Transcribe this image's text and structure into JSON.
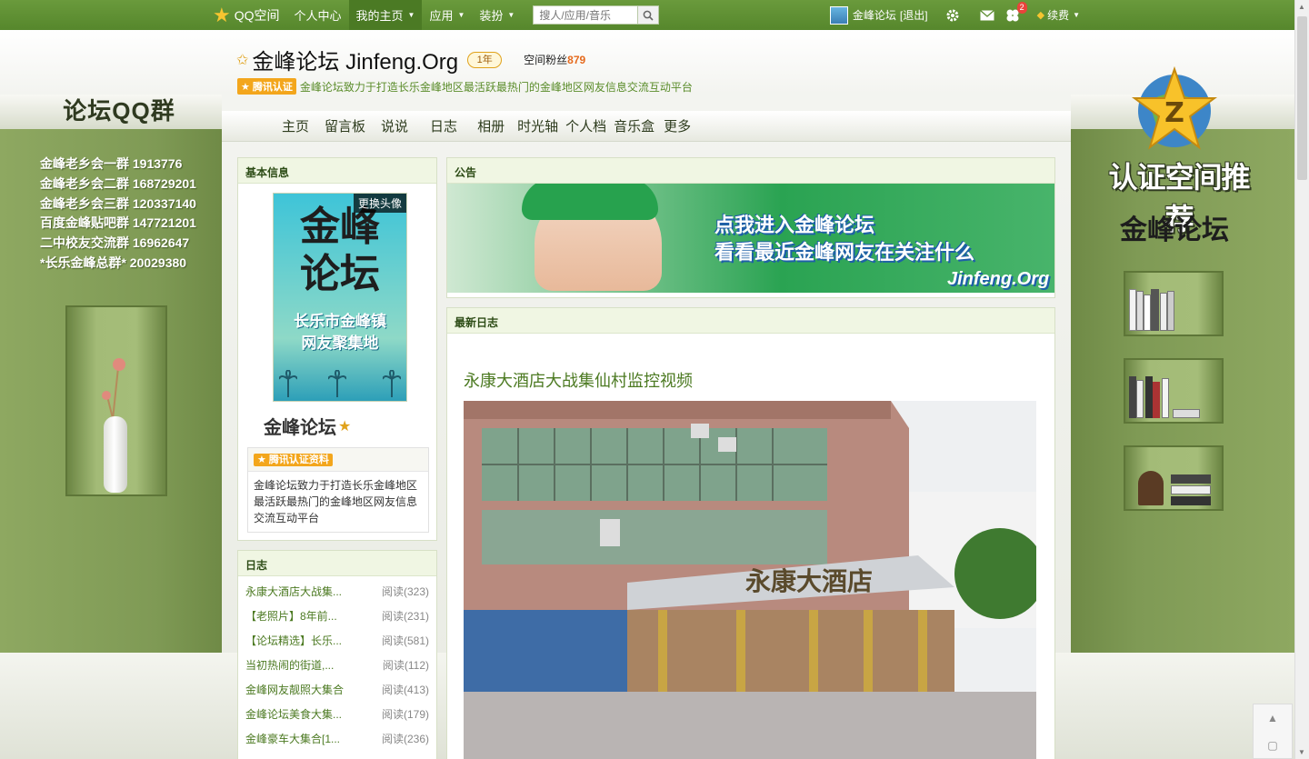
{
  "topbar": {
    "logo": "QQ空间",
    "nav": [
      "个人中心",
      "我的主页",
      "应用",
      "装扮"
    ],
    "search_placeholder": "搜人/应用/音乐",
    "user": "金峰论坛",
    "logout": "[退出]",
    "notification_count": "2",
    "renew": "续费"
  },
  "scene": {
    "left_title": "论坛QQ群",
    "qq_groups": [
      "金峰老乡会一群 1913776",
      "金峰老乡会二群 168729201",
      "金峰老乡会三群 120337140",
      "百度金峰贴吧群 147721201",
      "二中校友交流群 16962647",
      "*长乐金峰总群* 20029380"
    ],
    "right_title": "认证空间推荐",
    "right_sub": "金峰论坛"
  },
  "header": {
    "name": "金峰论坛  Jinfeng.Org",
    "years": "1年",
    "fans_label": "空间粉丝",
    "fans_count": "879",
    "cert_badge": "腾讯认证",
    "cert_text": "金峰论坛致力于打造长乐金峰地区最活跃最热门的金峰地区网友信息交流互动平台"
  },
  "nav": [
    "主页",
    "留言板",
    "说说",
    "日志",
    "相册",
    "时光轴",
    "个人档",
    "音乐盒",
    "更多"
  ],
  "basic_info": {
    "title": "基本信息",
    "avatar_big1": "金峰",
    "avatar_big2": "论坛",
    "avatar_sub1": "长乐市金峰镇",
    "avatar_sub2": "网友聚集地",
    "change_avatar": "更换头像",
    "owner": "金峰论坛",
    "cert_title": "腾讯认证资料",
    "cert_desc": "金峰论坛致力于打造长乐金峰地区最活跃最热门的金峰地区网友信息交流互动平台"
  },
  "blog": {
    "title": "日志",
    "items": [
      {
        "title": "永康大酒店大战集...",
        "reads": "阅读(323)"
      },
      {
        "title": "【老照片】8年前...",
        "reads": "阅读(231)"
      },
      {
        "title": "【论坛精选】长乐...",
        "reads": "阅读(581)"
      },
      {
        "title": "当初热闹的街道,...",
        "reads": "阅读(112)"
      },
      {
        "title": "金峰网友靓照大集合",
        "reads": "阅读(413)"
      },
      {
        "title": "金峰论坛美食大集...",
        "reads": "阅读(179)"
      },
      {
        "title": "金峰豪车大集合[1...",
        "reads": "阅读(236)"
      }
    ]
  },
  "notice": {
    "title": "公告",
    "line1": "点我进入金峰论坛",
    "line2": "看看最近金峰网友在关注什么",
    "domain": "Jinfeng.Org"
  },
  "latest": {
    "title": "最新日志",
    "post_title": "永康大酒店大战集仙村监控视频",
    "sign": "永康大酒店"
  },
  "colors": {
    "accent": "#5a8c2a",
    "topbar": "#5f9034",
    "fans": "#e56a1d"
  }
}
